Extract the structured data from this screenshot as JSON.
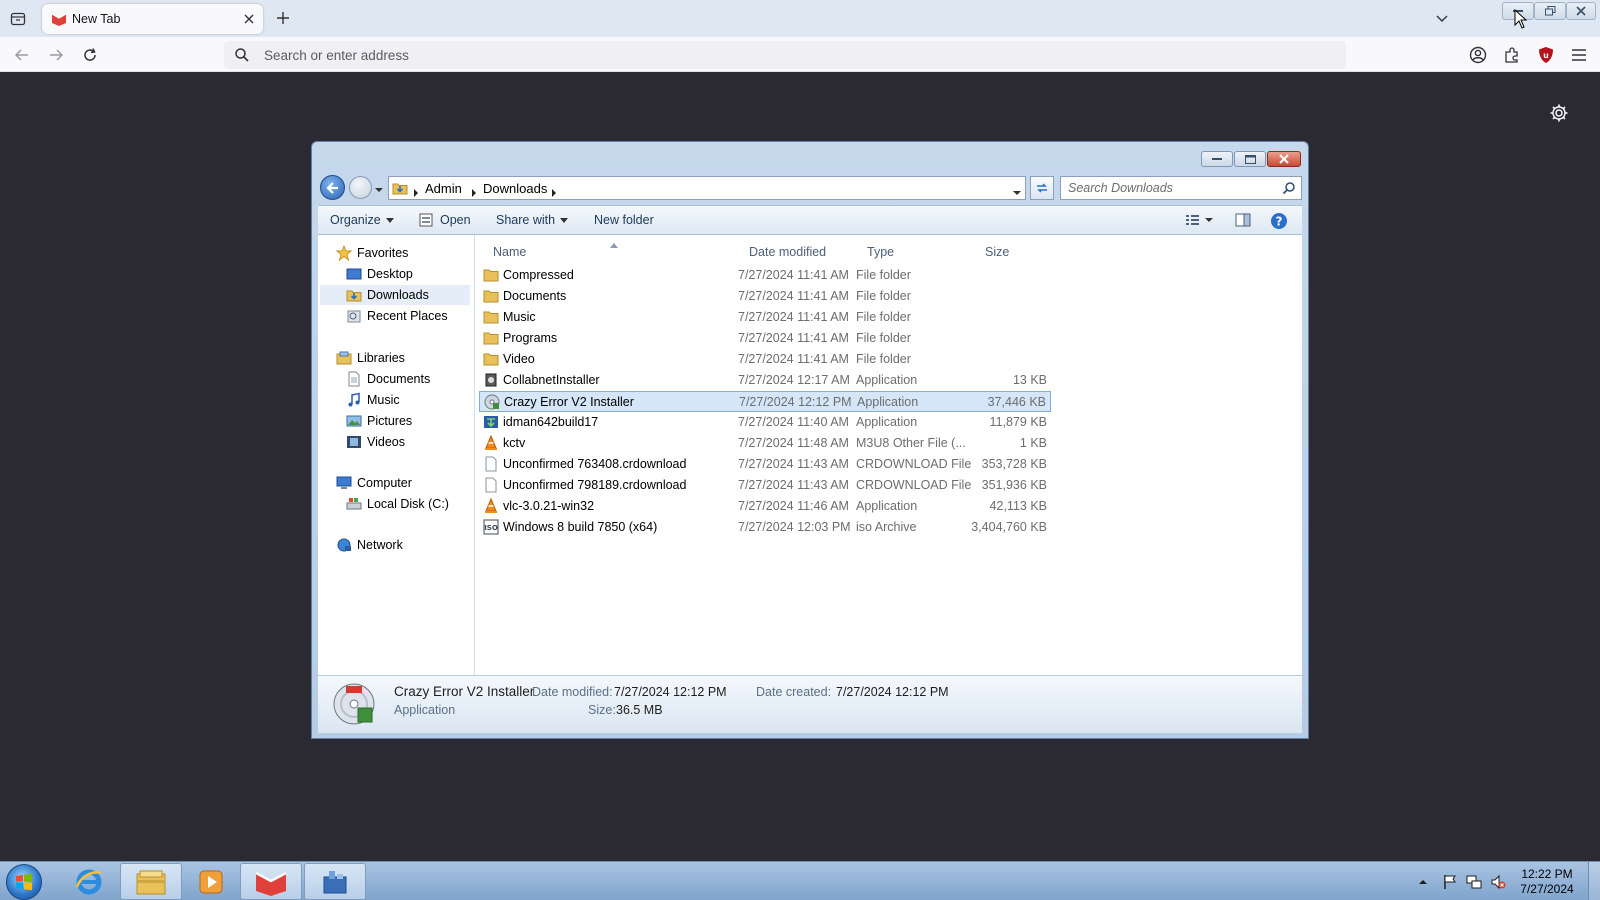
{
  "browser": {
    "tab_title": "New Tab",
    "url_placeholder": "Search or enter address"
  },
  "explorer": {
    "breadcrumb": [
      "Admin",
      "Downloads"
    ],
    "search_placeholder": "Search Downloads",
    "toolbar": {
      "organize": "Organize",
      "open": "Open",
      "share_with": "Share with",
      "new_folder": "New folder"
    },
    "nav": {
      "favorites": "Favorites",
      "desktop": "Desktop",
      "downloads": "Downloads",
      "recent_places": "Recent Places",
      "libraries": "Libraries",
      "documents": "Documents",
      "music": "Music",
      "pictures": "Pictures",
      "videos": "Videos",
      "computer": "Computer",
      "local_disk": "Local Disk (C:)",
      "network": "Network"
    },
    "columns": {
      "name": "Name",
      "date": "Date modified",
      "type": "Type",
      "size": "Size"
    },
    "files": [
      {
        "name": "Compressed",
        "date": "7/27/2024 11:41 AM",
        "type": "File folder",
        "size": "",
        "icon": "folder-icon"
      },
      {
        "name": "Documents",
        "date": "7/27/2024 11:41 AM",
        "type": "File folder",
        "size": "",
        "icon": "folder-icon"
      },
      {
        "name": "Music",
        "date": "7/27/2024 11:41 AM",
        "type": "File folder",
        "size": "",
        "icon": "folder-icon"
      },
      {
        "name": "Programs",
        "date": "7/27/2024 11:41 AM",
        "type": "File folder",
        "size": "",
        "icon": "folder-icon"
      },
      {
        "name": "Video",
        "date": "7/27/2024 11:41 AM",
        "type": "File folder",
        "size": "",
        "icon": "folder-icon"
      },
      {
        "name": "CollabnetInstaller",
        "date": "7/27/2024 12:17 AM",
        "type": "Application",
        "size": "13 KB",
        "icon": "installer-icon"
      },
      {
        "name": "Crazy Error V2 Installer",
        "date": "7/27/2024 12:12 PM",
        "type": "Application",
        "size": "37,446 KB",
        "icon": "disc-installer-icon"
      },
      {
        "name": "idman642build17",
        "date": "7/27/2024 11:40 AM",
        "type": "Application",
        "size": "11,879 KB",
        "icon": "idm-icon"
      },
      {
        "name": "kctv",
        "date": "7/27/2024 11:48 AM",
        "type": "M3U8 Other File (...",
        "size": "1 KB",
        "icon": "vlc-cone-icon"
      },
      {
        "name": "Unconfirmed 763408.crdownload",
        "date": "7/27/2024 11:43 AM",
        "type": "CRDOWNLOAD File",
        "size": "353,728 KB",
        "icon": "blank-file-icon"
      },
      {
        "name": "Unconfirmed 798189.crdownload",
        "date": "7/27/2024 11:43 AM",
        "type": "CRDOWNLOAD File",
        "size": "351,936 KB",
        "icon": "blank-file-icon"
      },
      {
        "name": "vlc-3.0.21-win32",
        "date": "7/27/2024 11:46 AM",
        "type": "Application",
        "size": "42,113 KB",
        "icon": "vlc-cone-icon"
      },
      {
        "name": "Windows 8 build 7850 (x64)",
        "date": "7/27/2024 12:03 PM",
        "type": "iso Archive",
        "size": "3,404,760 KB",
        "icon": "iso-icon"
      }
    ],
    "details": {
      "name": "Crazy Error V2 Installer",
      "kind": "Application",
      "date_modified_label": "Date modified:",
      "date_modified": "7/27/2024 12:12 PM",
      "date_created_label": "Date created:",
      "date_created": "7/27/2024 12:12 PM",
      "size_label": "Size:",
      "size": "36.5 MB"
    }
  },
  "taskbar": {
    "time": "12:22 PM",
    "date": "7/27/2024"
  }
}
